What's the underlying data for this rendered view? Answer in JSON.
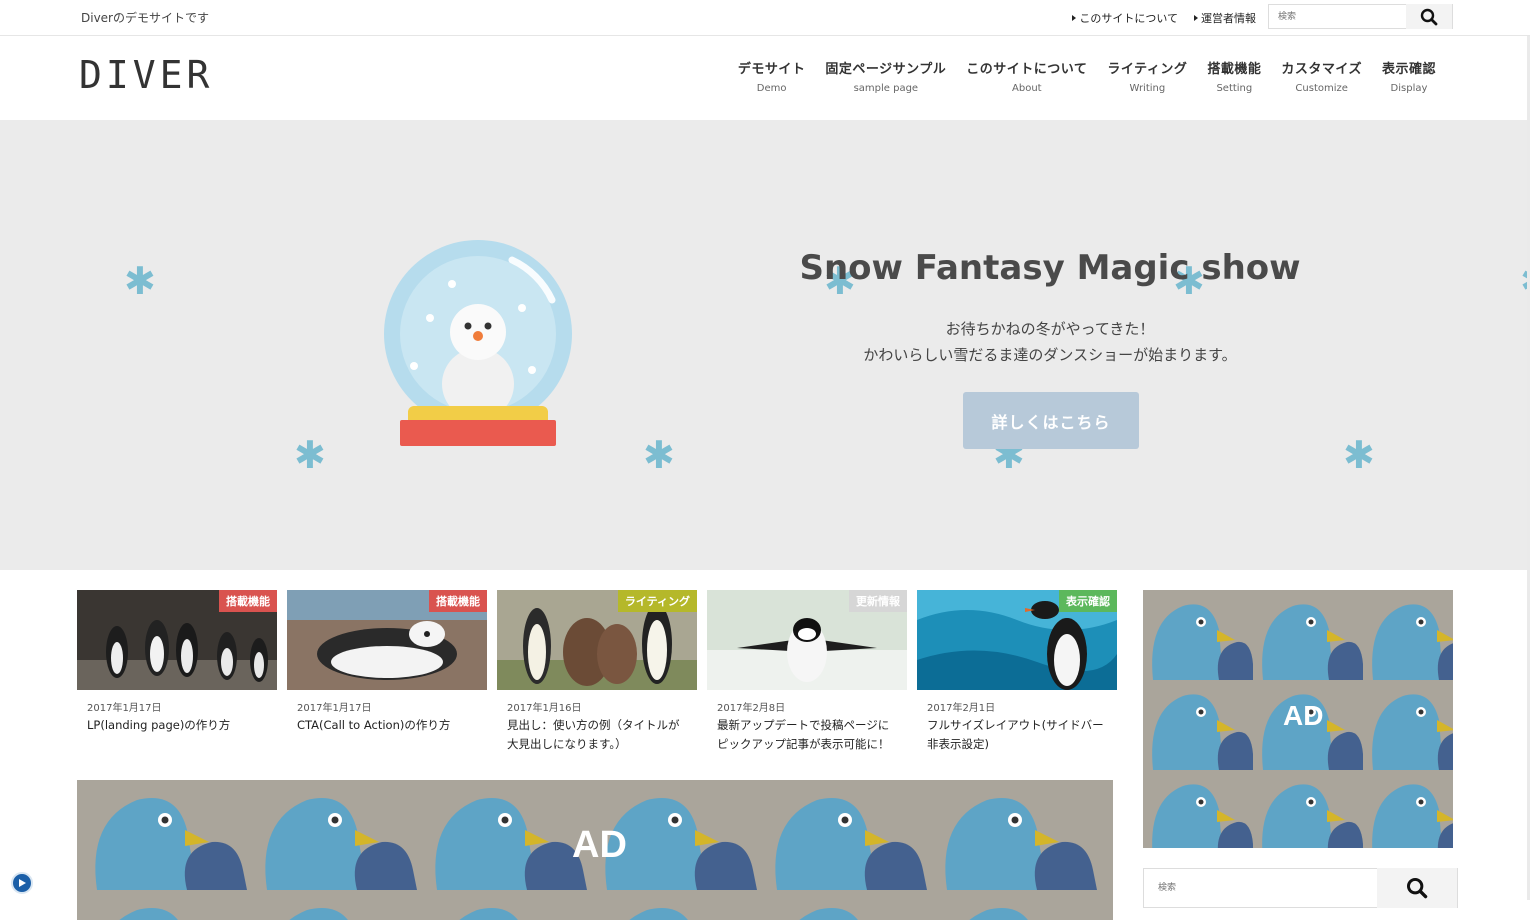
{
  "topbar": {
    "tagline": "Diverのデモサイトです",
    "links": [
      "このサイトについて",
      "運営者情報"
    ],
    "search_placeholder": "検索"
  },
  "header": {
    "logo": "DIVER",
    "nav": [
      {
        "jp": "デモサイト",
        "en": "Demo"
      },
      {
        "jp": "固定ページサンプル",
        "en": "sample page"
      },
      {
        "jp": "このサイトについて",
        "en": "About"
      },
      {
        "jp": "ライティング",
        "en": "Writing"
      },
      {
        "jp": "搭載機能",
        "en": "Setting"
      },
      {
        "jp": "カスタマイズ",
        "en": "Customize"
      },
      {
        "jp": "表示確認",
        "en": "Display"
      }
    ]
  },
  "hero": {
    "title": "Snow Fantasy Magic show",
    "line1": "お待ちかねの冬がやってきた！",
    "line2": "かわいらしい雪だるま達のダンスショーが始まります。",
    "button": "詳しくはこちら"
  },
  "cards": [
    {
      "category": "搭載機能",
      "cat_color": "#d9534f",
      "date": "2017年1月17日",
      "title": "LP(landing page)の作り方"
    },
    {
      "category": "搭載機能",
      "cat_color": "#d9534f",
      "date": "2017年1月17日",
      "title": "CTA(Call to Action)の作り方"
    },
    {
      "category": "ライティング",
      "cat_color": "#b5b82a",
      "date": "2017年1月16日",
      "title": "見出し：使い方の例（タイトルが大見出しになります。）"
    },
    {
      "category": "更新情報",
      "cat_color": "#d6d6d6",
      "date": "2017年2月8日",
      "title": "最新アップデートで投稿ページにピックアップ記事が表示可能に！"
    },
    {
      "category": "表示確認",
      "cat_color": "#5cb85c",
      "date": "2017年2月1日",
      "title": "フルサイズレイアウト(サイドバー非表示設定)"
    }
  ],
  "ads": {
    "banner_label": "AD",
    "side_label": "AD"
  },
  "sidebar": {
    "search_placeholder": "検索"
  },
  "colors": {
    "snowflake": "#7cbdd1",
    "hero_bg": "#ebebeb",
    "button": "#b7c9d9",
    "ad_bg": "#aaa59b"
  }
}
